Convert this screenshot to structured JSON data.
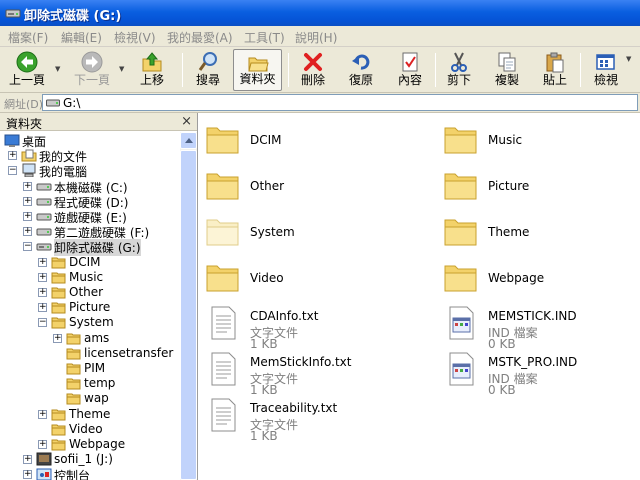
{
  "window": {
    "title": "卸除式磁碟 (G:)"
  },
  "menu": [
    "檔案(F)",
    "編輯(E)",
    "檢視(V)",
    "我的最愛(A)",
    "工具(T)",
    "說明(H)"
  ],
  "toolbar": {
    "back": "上一頁",
    "forward": "下一頁",
    "up": "上移",
    "search": "搜尋",
    "folders": "資料夾",
    "delete": "刪除",
    "undo": "復原",
    "properties": "內容",
    "cut": "剪下",
    "copy": "複製",
    "paste": "貼上",
    "views": "檢視"
  },
  "address": {
    "label": "網址(D)",
    "path": "G:\\"
  },
  "folders_pane": {
    "title": "資料夾",
    "close": "×",
    "tree": [
      {
        "label": "桌面",
        "icon": "desktop-icon",
        "exp": ""
      },
      {
        "label": "我的文件",
        "icon": "my-documents-icon",
        "exp": "+"
      },
      {
        "label": "我的電腦",
        "icon": "my-computer-icon",
        "exp": "−"
      },
      {
        "label": "本機磁碟 (C:)",
        "icon": "drive-icon",
        "exp": "+"
      },
      {
        "label": "程式硬碟 (D:)",
        "icon": "drive-icon",
        "exp": "+"
      },
      {
        "label": "遊戲硬碟 (E:)",
        "icon": "drive-icon",
        "exp": "+"
      },
      {
        "label": "第二遊戲硬碟 (F:)",
        "icon": "drive-icon",
        "exp": "+"
      },
      {
        "label": "卸除式磁碟 (G:)",
        "icon": "removable-drive-icon",
        "exp": "−"
      },
      {
        "label": "DCIM",
        "icon": "folder-icon",
        "exp": "+"
      },
      {
        "label": "Music",
        "icon": "folder-icon",
        "exp": "+"
      },
      {
        "label": "Other",
        "icon": "folder-icon",
        "exp": "+"
      },
      {
        "label": "Picture",
        "icon": "folder-icon",
        "exp": "+"
      },
      {
        "label": "System",
        "icon": "folder-icon",
        "exp": "−"
      },
      {
        "label": "ams",
        "icon": "folder-icon",
        "exp": "+"
      },
      {
        "label": "licensetransfer",
        "icon": "folder-icon",
        "exp": ""
      },
      {
        "label": "PIM",
        "icon": "folder-icon",
        "exp": ""
      },
      {
        "label": "temp",
        "icon": "folder-icon",
        "exp": ""
      },
      {
        "label": "wap",
        "icon": "folder-icon",
        "exp": ""
      },
      {
        "label": "Theme",
        "icon": "folder-icon",
        "exp": "+"
      },
      {
        "label": "Video",
        "icon": "folder-icon",
        "exp": ""
      },
      {
        "label": "Webpage",
        "icon": "folder-icon",
        "exp": "+"
      },
      {
        "label": "sofii_1 (J:)",
        "icon": "network-drive-icon",
        "exp": "+"
      },
      {
        "label": "控制台",
        "icon": "control-panel-icon",
        "exp": "+"
      }
    ]
  },
  "items": [
    {
      "name": "DCIM",
      "kind": "folder",
      "faded": false
    },
    {
      "name": "Music",
      "kind": "folder",
      "faded": false
    },
    {
      "name": "Other",
      "kind": "folder",
      "faded": false
    },
    {
      "name": "Picture",
      "kind": "folder",
      "faded": false
    },
    {
      "name": "System",
      "kind": "folder",
      "faded": true
    },
    {
      "name": "Theme",
      "kind": "folder",
      "faded": false
    },
    {
      "name": "Video",
      "kind": "folder",
      "faded": false
    },
    {
      "name": "Webpage",
      "kind": "folder",
      "faded": false
    },
    {
      "name": "CDAInfo.txt",
      "kind": "text",
      "type": "文字文件",
      "size": "1 KB"
    },
    {
      "name": "MEMSTICK.IND",
      "kind": "ind",
      "type": "IND 檔案",
      "size": "0 KB"
    },
    {
      "name": "MemStickInfo.txt",
      "kind": "text",
      "type": "文字文件",
      "size": "1 KB"
    },
    {
      "name": "MSTK_PRO.IND",
      "kind": "ind",
      "type": "IND 檔案",
      "size": "0 KB"
    },
    {
      "name": "Traceability.txt",
      "kind": "text",
      "type": "文字文件",
      "size": "1 KB"
    }
  ],
  "colors": {
    "titlebar": "#0553d6",
    "chrome": "#ece9d8",
    "folder": "#f3d26a"
  }
}
